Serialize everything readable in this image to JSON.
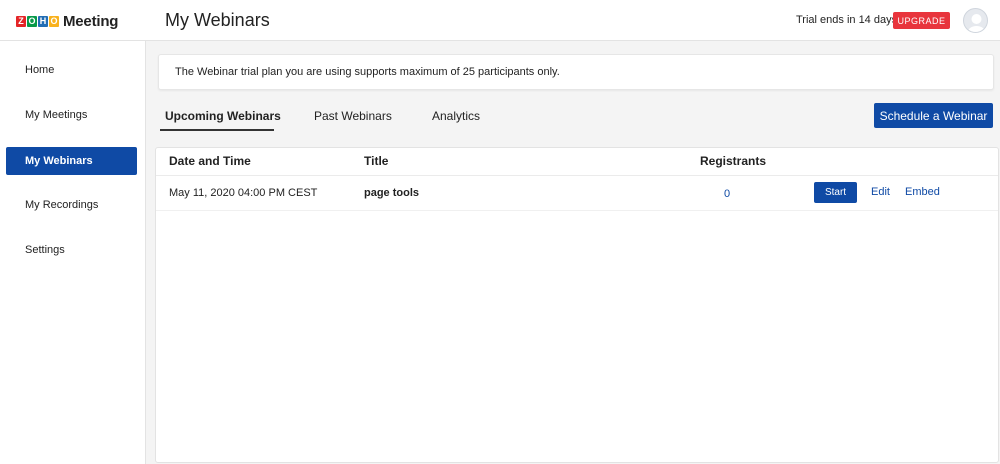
{
  "header": {
    "logo_letters": [
      "Z",
      "O",
      "H",
      "O"
    ],
    "logo_colors": [
      "#e42527",
      "#089949",
      "#226db4",
      "#f9b21d"
    ],
    "app_name": "Meeting",
    "page_title": "My Webinars",
    "trial_text": "Trial ends in 14 days",
    "upgrade_label": "UPGRADE",
    "upgrade_color": "#e8353d"
  },
  "sidebar": {
    "items": [
      {
        "label": "Home"
      },
      {
        "label": "My Meetings"
      },
      {
        "label": "My Webinars",
        "active": true
      },
      {
        "label": "My Recordings"
      },
      {
        "label": "Settings"
      }
    ],
    "active_color": "#0f4aa5"
  },
  "banner": {
    "text": "The Webinar trial plan you are using supports maximum of 25 participants only."
  },
  "tabs": [
    {
      "label": "Upcoming Webinars",
      "active": true
    },
    {
      "label": "Past Webinars"
    },
    {
      "label": "Analytics"
    }
  ],
  "schedule_button": "Schedule a Webinar",
  "table": {
    "headers": [
      "Date and Time",
      "Title",
      "Registrants"
    ],
    "rows": [
      {
        "date_time": "May 11, 2020 04:00 PM CEST",
        "title": "page tools",
        "registrants": "0",
        "start_label": "Start",
        "edit_label": "Edit",
        "embed_label": "Embed"
      }
    ]
  }
}
